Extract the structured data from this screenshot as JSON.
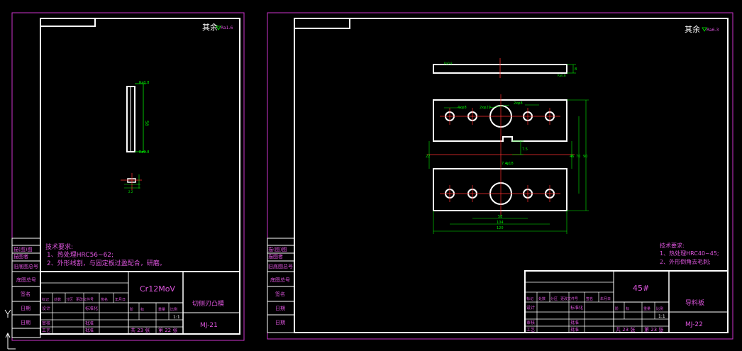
{
  "colors": {
    "background": "#000000",
    "frame": "#cc33cc",
    "border": "#ffffff",
    "text": "#dd55dd",
    "dim": "#00ee00",
    "center": "#ff3030"
  },
  "sheet_left": {
    "roughness": "其余",
    "roughness_val": "Ra1.6",
    "tech_title": "技术要求:",
    "tech_1": "1、热处理HRC56~62;",
    "tech_2": "2、外形线割，与固定板过盈配合，研磨。",
    "material": "Cr12MoV",
    "part_name": "切侧刃凸模",
    "drawing_no": "MJ-21",
    "sheets_total": "共 23 张",
    "sheet_no": "第 22 张",
    "scale": "1:1",
    "side_labels": [
      "描(图)图",
      "描图者",
      "旧底图总号",
      "底图总号",
      "签名",
      "日期",
      "日期"
    ],
    "dims": [
      "Ra0.8",
      "58",
      "Ra0.8",
      "2.2"
    ]
  },
  "sheet_right": {
    "roughness": "其余",
    "roughness_val": "Ra6.3",
    "tech_title": "技术要求:",
    "tech_1": "1、热处理HRC40~45;",
    "tech_2": "2、外形倒角去毛刺;",
    "material": "45#",
    "part_name": "导料板",
    "drawing_no": "MJ-22",
    "sheets_total": "共 23 张",
    "sheet_no": "第 23 张",
    "scale": "1:1",
    "side_labels": [
      "描(图)图",
      "描图者",
      "旧底图总号",
      "底图总号",
      "签名",
      "日期",
      "日期"
    ],
    "dims": [
      "Ra0.8",
      "Ra0.8",
      "8",
      "4xφ8",
      "2xφ20",
      "2xφ8",
      "φ18",
      "22",
      "46",
      "70",
      "90",
      "7.5",
      "7.4",
      "58",
      "104",
      "120"
    ]
  },
  "title_block": {
    "r1": [
      "标记",
      "处数",
      "分区",
      "更改文件号",
      "签名",
      "年月日"
    ],
    "r2": [
      "设计",
      "标准化"
    ],
    "r3": [
      "审核",
      "批准"
    ],
    "r4": [
      "工艺",
      "批准"
    ],
    "stage_labels": [
      "阶",
      "段",
      "标",
      "记",
      "重量",
      "比例"
    ]
  }
}
